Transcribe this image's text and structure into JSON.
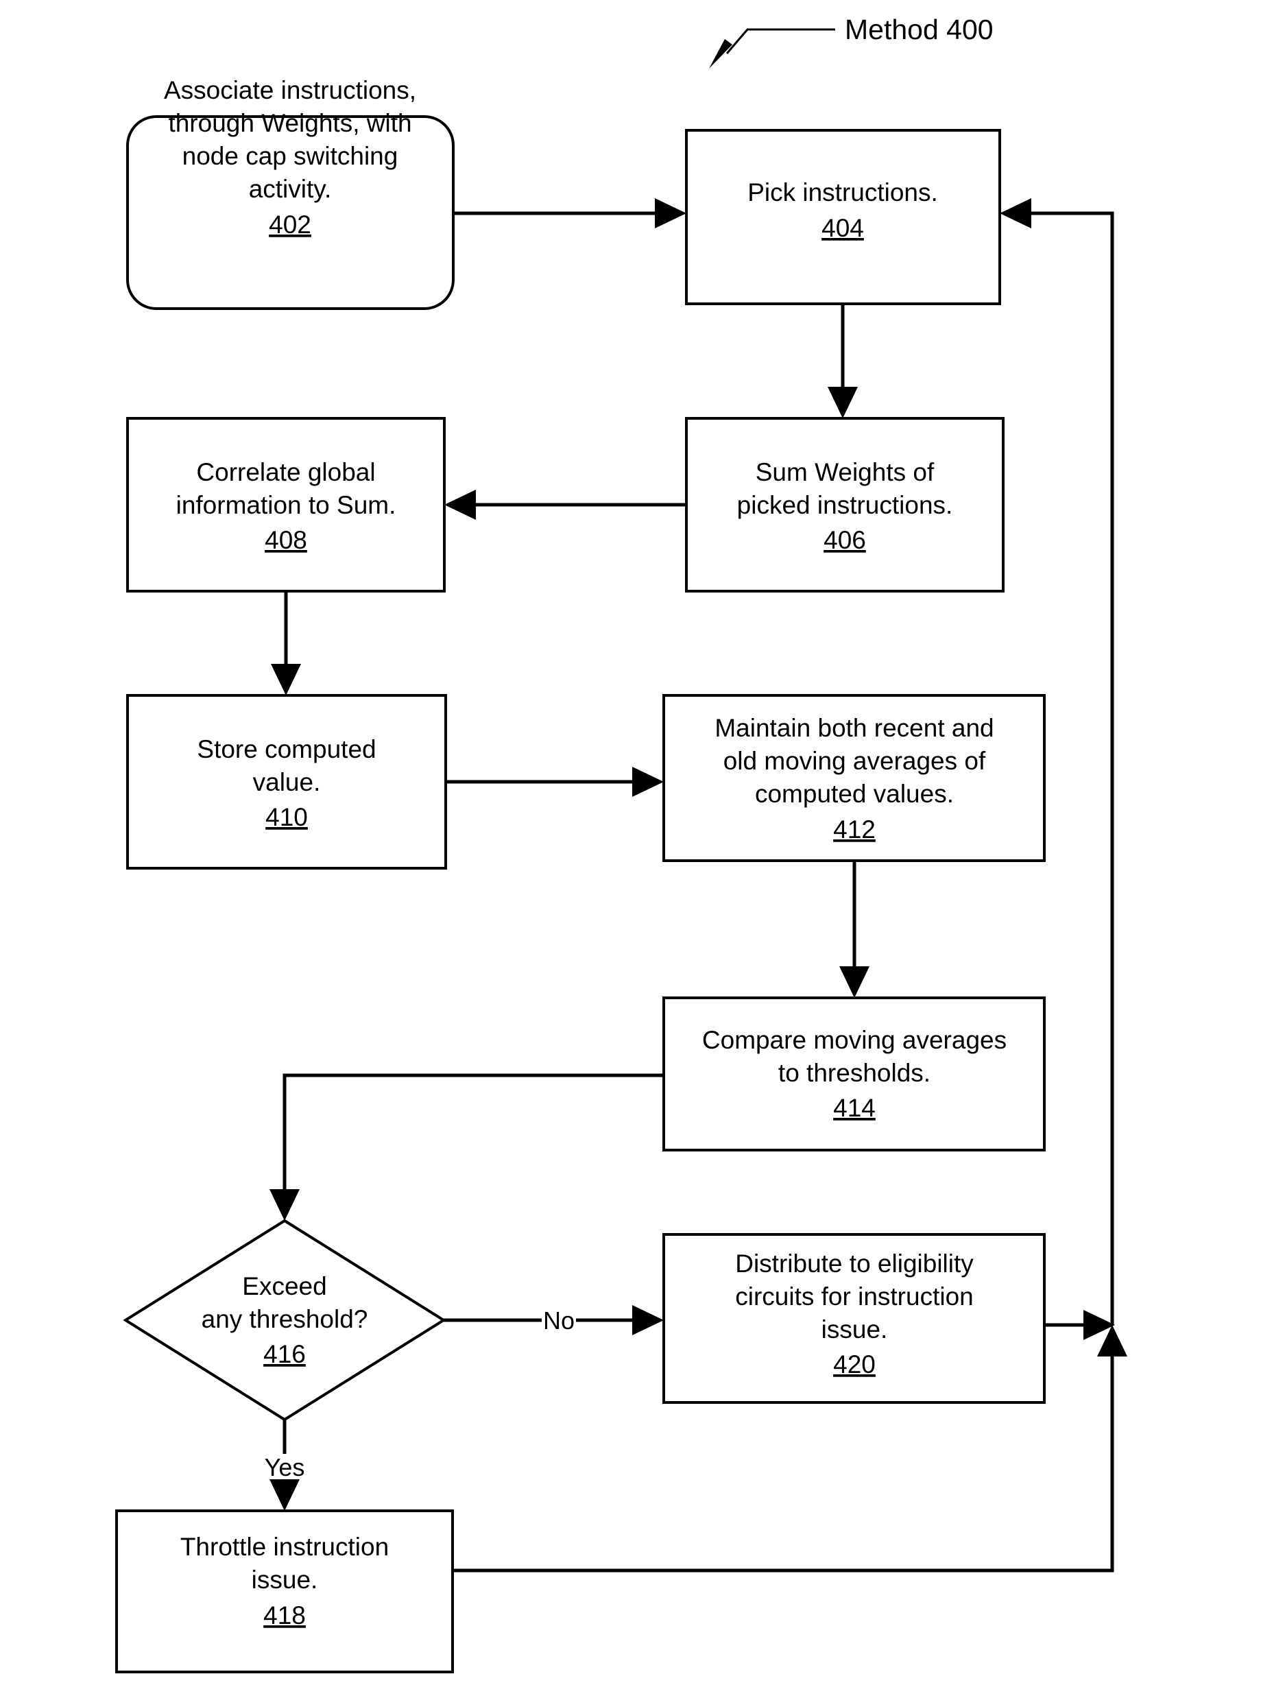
{
  "figure": {
    "title": "Method 400",
    "title_ref": "400"
  },
  "nodes": [
    {
      "id": "n402",
      "ref": "402",
      "shape": "rounded-rect",
      "lines": [
        "Associate instructions,",
        "through Weights, with",
        "node cap switching",
        "activity."
      ]
    },
    {
      "id": "n404",
      "ref": "404",
      "shape": "rect",
      "lines": [
        "Pick instructions."
      ]
    },
    {
      "id": "n406",
      "ref": "406",
      "shape": "rect",
      "lines": [
        "Sum Weights of",
        "picked instructions."
      ]
    },
    {
      "id": "n408",
      "ref": "408",
      "shape": "rect",
      "lines": [
        "Correlate global",
        "information to Sum."
      ]
    },
    {
      "id": "n410",
      "ref": "410",
      "shape": "rect",
      "lines": [
        "Store computed",
        "value."
      ]
    },
    {
      "id": "n412",
      "ref": "412",
      "shape": "rect",
      "lines": [
        "Maintain both recent and",
        "old moving averages of",
        "computed values."
      ]
    },
    {
      "id": "n414",
      "ref": "414",
      "shape": "rect",
      "lines": [
        "Compare moving averages",
        "to thresholds."
      ]
    },
    {
      "id": "n416",
      "ref": "416",
      "shape": "diamond",
      "lines": [
        "Exceed",
        "any threshold?"
      ]
    },
    {
      "id": "n418",
      "ref": "418",
      "shape": "rect",
      "lines": [
        "Throttle instruction",
        "issue."
      ]
    },
    {
      "id": "n420",
      "ref": "420",
      "shape": "rect",
      "lines": [
        "Distribute to eligibility",
        "circuits for instruction",
        "issue."
      ]
    }
  ],
  "edge_labels": {
    "no": "No",
    "yes": "Yes"
  },
  "colors": {
    "stroke": "#000000",
    "fill": "#ffffff",
    "text": "#000000"
  }
}
